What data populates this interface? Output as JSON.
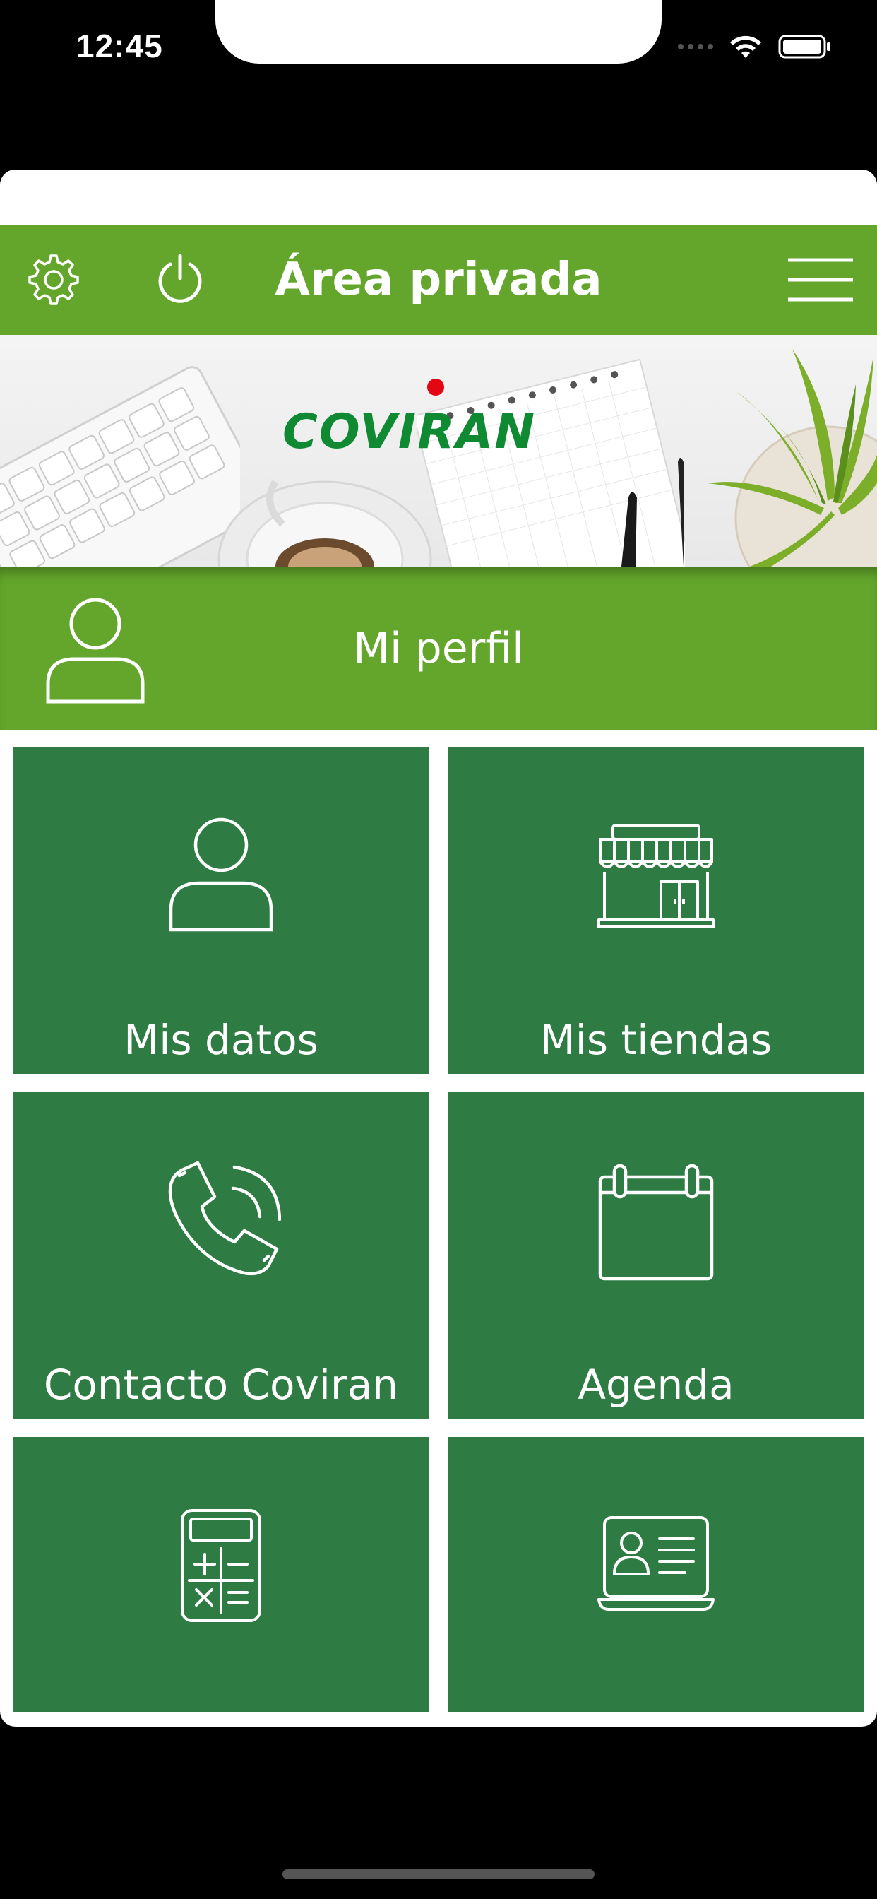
{
  "status_bar": {
    "time": "12:45"
  },
  "header": {
    "title": "Área privada",
    "settings_icon": "gear-icon",
    "power_icon": "power-icon",
    "menu_icon": "hamburger-menu-icon"
  },
  "banner": {
    "logo_text": "COVIRAN"
  },
  "profile": {
    "label": "Mi perfil",
    "icon": "user-icon"
  },
  "tiles": [
    {
      "label": "Mis datos",
      "icon": "user-icon"
    },
    {
      "label": "Mis tiendas",
      "icon": "store-icon"
    },
    {
      "label": "Contacto Coviran",
      "icon": "phone-icon"
    },
    {
      "label": "Agenda",
      "icon": "calendar-icon"
    },
    {
      "label": "",
      "icon": "calculator-icon"
    },
    {
      "label": "",
      "icon": "id-card-laptop-icon"
    }
  ],
  "colors": {
    "header_green": "#63a62b",
    "tile_green": "#2e7b43",
    "logo_green": "#0f8a33",
    "logo_dot_red": "#e30613"
  }
}
